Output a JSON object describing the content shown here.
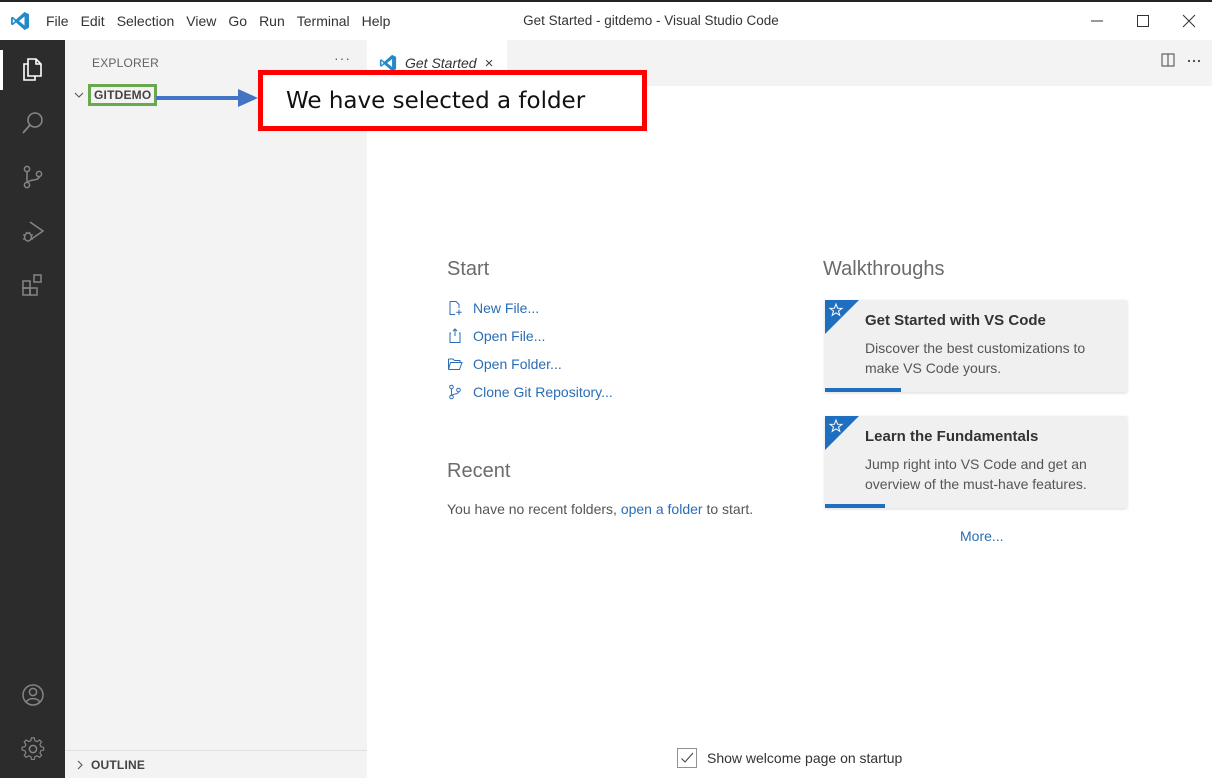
{
  "window": {
    "title": "Get Started - gitdemo - Visual Studio Code"
  },
  "menu": [
    "File",
    "Edit",
    "Selection",
    "View",
    "Go",
    "Run",
    "Terminal",
    "Help"
  ],
  "activity_bar": {
    "top_icons": [
      "files-icon",
      "search-icon",
      "source-control-icon",
      "run-debug-icon",
      "extensions-icon"
    ],
    "bottom_icons": [
      "accounts-icon",
      "settings-gear-icon"
    ]
  },
  "sidebar": {
    "header": "EXPLORER",
    "more": "···",
    "folder": "GITDEMO",
    "outline": "OUTLINE"
  },
  "tab": {
    "label": "Get Started",
    "close": "×"
  },
  "welcome": {
    "start": {
      "title": "Start",
      "items": [
        "New File...",
        "Open File...",
        "Open Folder...",
        "Clone Git Repository..."
      ]
    },
    "recent": {
      "title": "Recent",
      "text_before": "You have no recent folders, ",
      "link": "open a folder",
      "text_after": " to start."
    },
    "walkthroughs": {
      "title": "Walkthroughs",
      "cards": [
        {
          "title": "Get Started with VS Code",
          "description": "Discover the best customizations to make VS Code yours."
        },
        {
          "title": "Learn the Fundamentals",
          "description": "Jump right into VS Code and get an overview of the must-have features."
        }
      ],
      "more": "More..."
    },
    "show_on_startup": {
      "label": "Show welcome page on startup",
      "checked": true
    }
  },
  "annotation": {
    "text": "We have selected a folder"
  },
  "colors": {
    "activity_bar": "#2c2c2c",
    "sidebar": "#f3f3f3",
    "link": "#2a6db5",
    "annotation_border": "#ff0000",
    "folder_highlight": "#6aa84f",
    "arrow": "#4472c4"
  }
}
